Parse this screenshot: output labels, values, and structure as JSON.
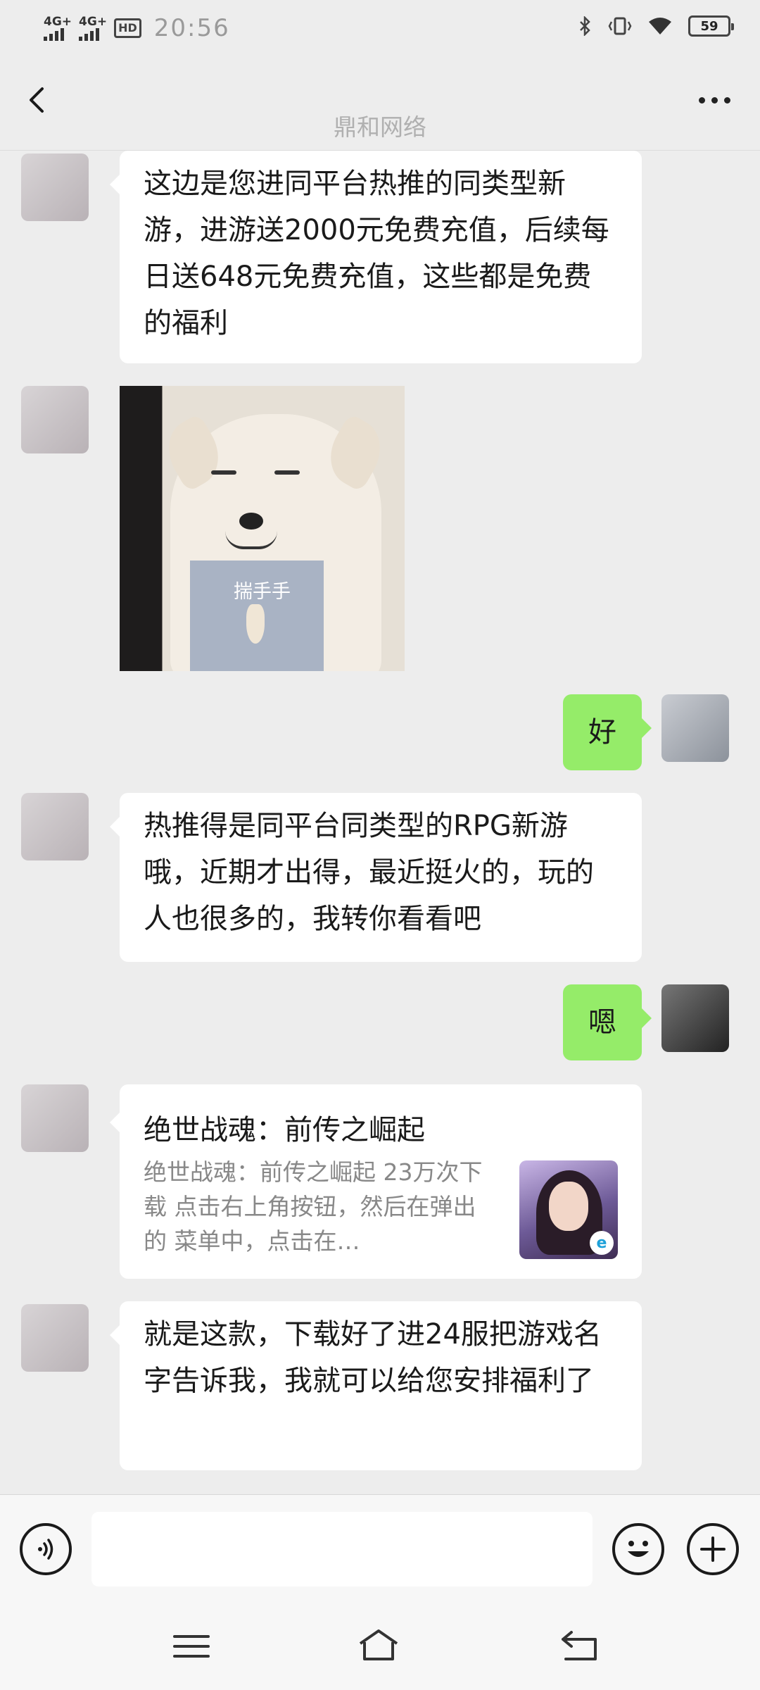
{
  "status_bar": {
    "network_1": "4G+",
    "network_2": "4G+",
    "hd": "HD",
    "time": "20:56",
    "battery": "59"
  },
  "header": {
    "title": "鼎和网络",
    "back_icon": "chevron-left-icon",
    "more_icon": "more-dots-icon"
  },
  "messages": [
    {
      "side": "left",
      "text": "这边是您进同平台热推的同类型新游，进游送2000元免费充值，后续每日送648元免费充值，这些都是免费的福利"
    },
    {
      "side": "left",
      "type": "sticker",
      "caption": "揣手手"
    },
    {
      "side": "right",
      "text": "好"
    },
    {
      "side": "left",
      "text": "热推得是同平台同类型的RPG新游哦，近期才出得，最近挺火的，玩的人也很多的，我转你看看吧"
    },
    {
      "side": "right",
      "text": "嗯"
    },
    {
      "side": "left",
      "type": "link",
      "title": "绝世战魂：前传之崛起",
      "desc": "绝世战魂：前传之崛起 23万次下载 点击右上角按钮，然后在弹出的 菜单中，点击在…"
    },
    {
      "side": "left",
      "text": "就是这款，下载好了进24服把游戏名字告诉我，我就可以给您安排福利了"
    }
  ],
  "input_bar": {
    "placeholder": "",
    "voice_icon": "voice-icon",
    "emoji_icon": "emoji-icon",
    "plus_icon": "plus-icon"
  },
  "nav_bar": {
    "menu_icon": "menu-icon",
    "home_icon": "home-icon",
    "back_icon": "back-icon"
  },
  "colors": {
    "background": "#ededed",
    "bubble_self": "#95ec69",
    "bubble_other": "#ffffff"
  }
}
